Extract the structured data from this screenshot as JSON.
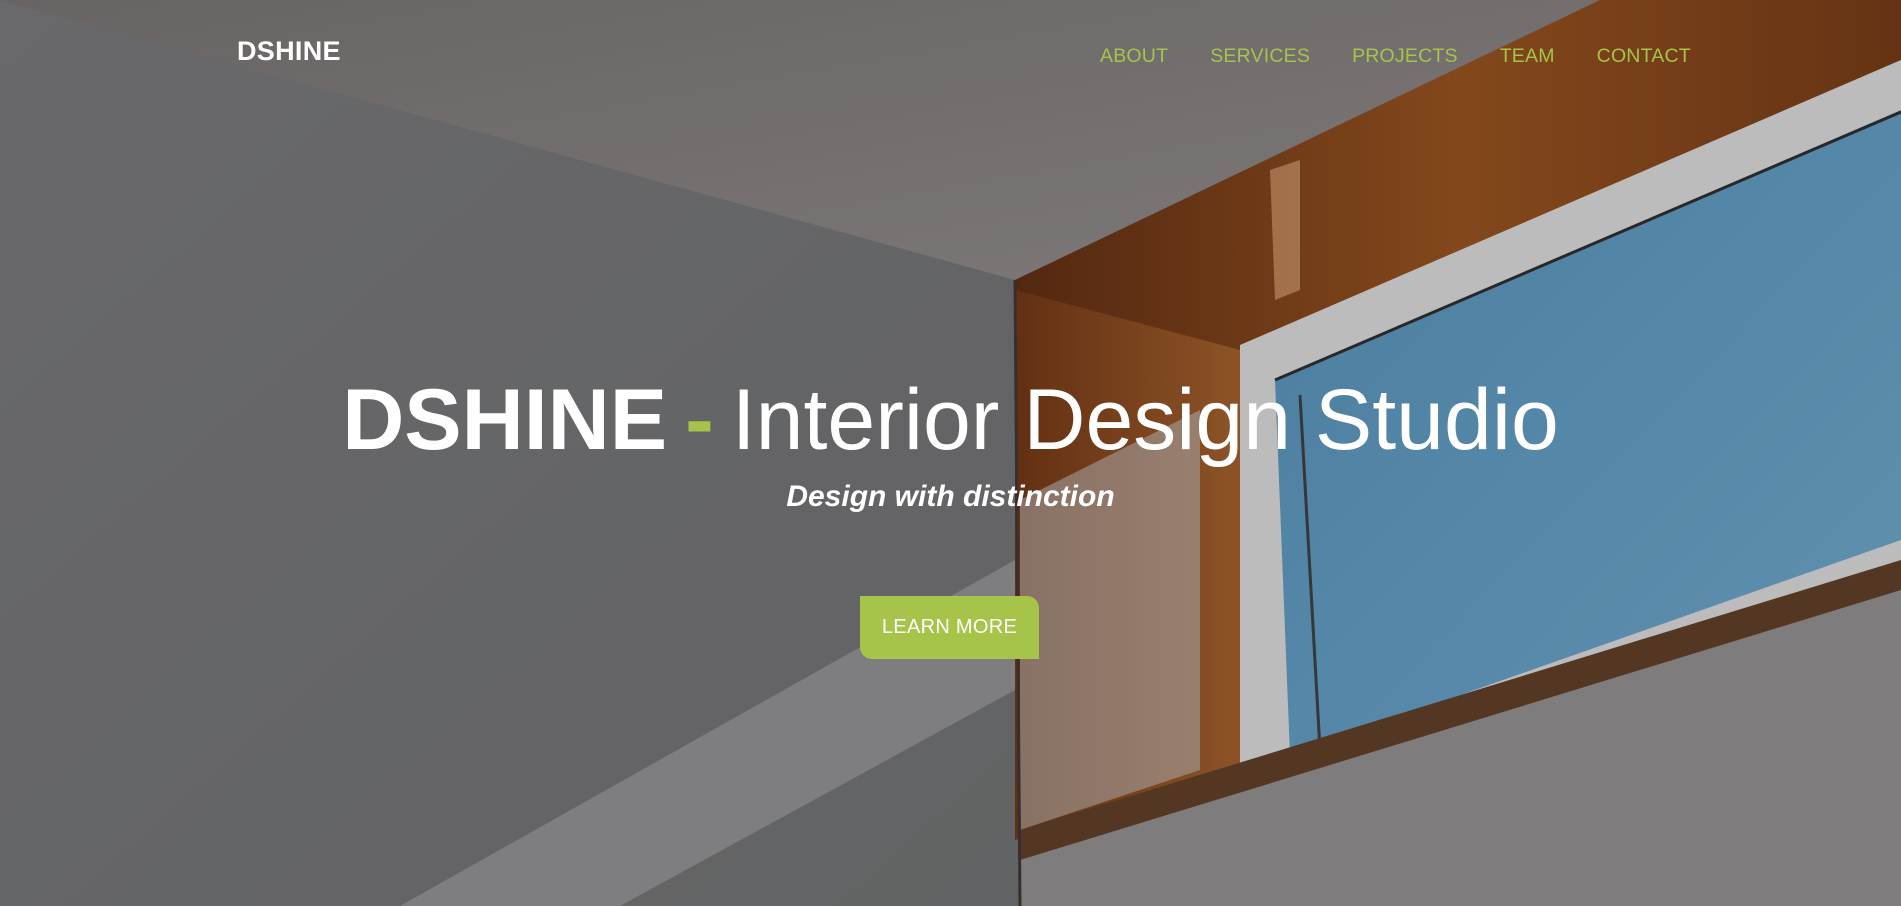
{
  "brand": {
    "logo_text": "DSHINE"
  },
  "nav": {
    "items": [
      {
        "label": "ABOUT"
      },
      {
        "label": "SERVICES"
      },
      {
        "label": "PROJECTS"
      },
      {
        "label": "TEAM"
      },
      {
        "label": "CONTACT"
      }
    ]
  },
  "hero": {
    "title_brand": "DSHINE",
    "title_separator": "-",
    "title_rest": "Interior Design Studio",
    "tagline": "Design with distinction",
    "cta_label": "LEARN MORE"
  },
  "colors": {
    "accent": "#a6c34a",
    "text_light": "#ffffff",
    "wall": "#7b7b7d",
    "wood": "#8a4a1c",
    "sky": "#5b8fb2"
  }
}
